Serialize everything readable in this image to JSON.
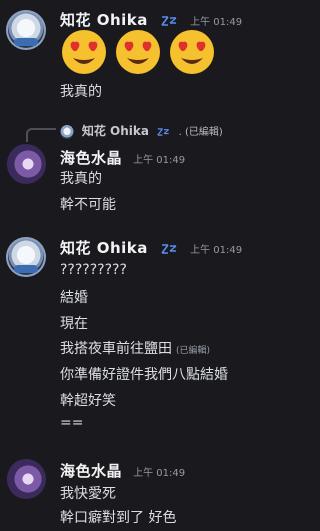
{
  "colors": {
    "background": "#1a1a1e",
    "username": "#f2f3f5",
    "timestamp": "#949ba4",
    "text": "#dbdee1"
  },
  "group1": {
    "username": "知花 Ohika",
    "badge_icon": "zzz-sleep-icon",
    "time": "上午 01:49",
    "reactions": [
      "heart-eyes-emoji",
      "heart-eyes-emoji",
      "heart-eyes-emoji"
    ],
    "line1": "我真的"
  },
  "reply": {
    "username": "知花 Ohika",
    "badge_icon": "zzz-sleep-icon",
    "preview": ". (已編輯)"
  },
  "group2": {
    "username": "海色水晶",
    "time": "上午 01:49",
    "lines": [
      "我真的",
      "幹不可能"
    ]
  },
  "group3": {
    "username": "知花 Ohika",
    "badge_icon": "zzz-sleep-icon",
    "time": "上午 01:49",
    "lines": [
      "?????????",
      "結婚",
      "現在",
      "我搭夜車前往鹽田",
      "你準備好證件我們八點結婚",
      "幹超好笑",
      "=="
    ],
    "edited": "(已編輯)"
  },
  "group4": {
    "username": "海色水晶",
    "time": "上午 01:49",
    "lines": [
      "我快愛死",
      "幹口癖對到了 好色"
    ]
  }
}
